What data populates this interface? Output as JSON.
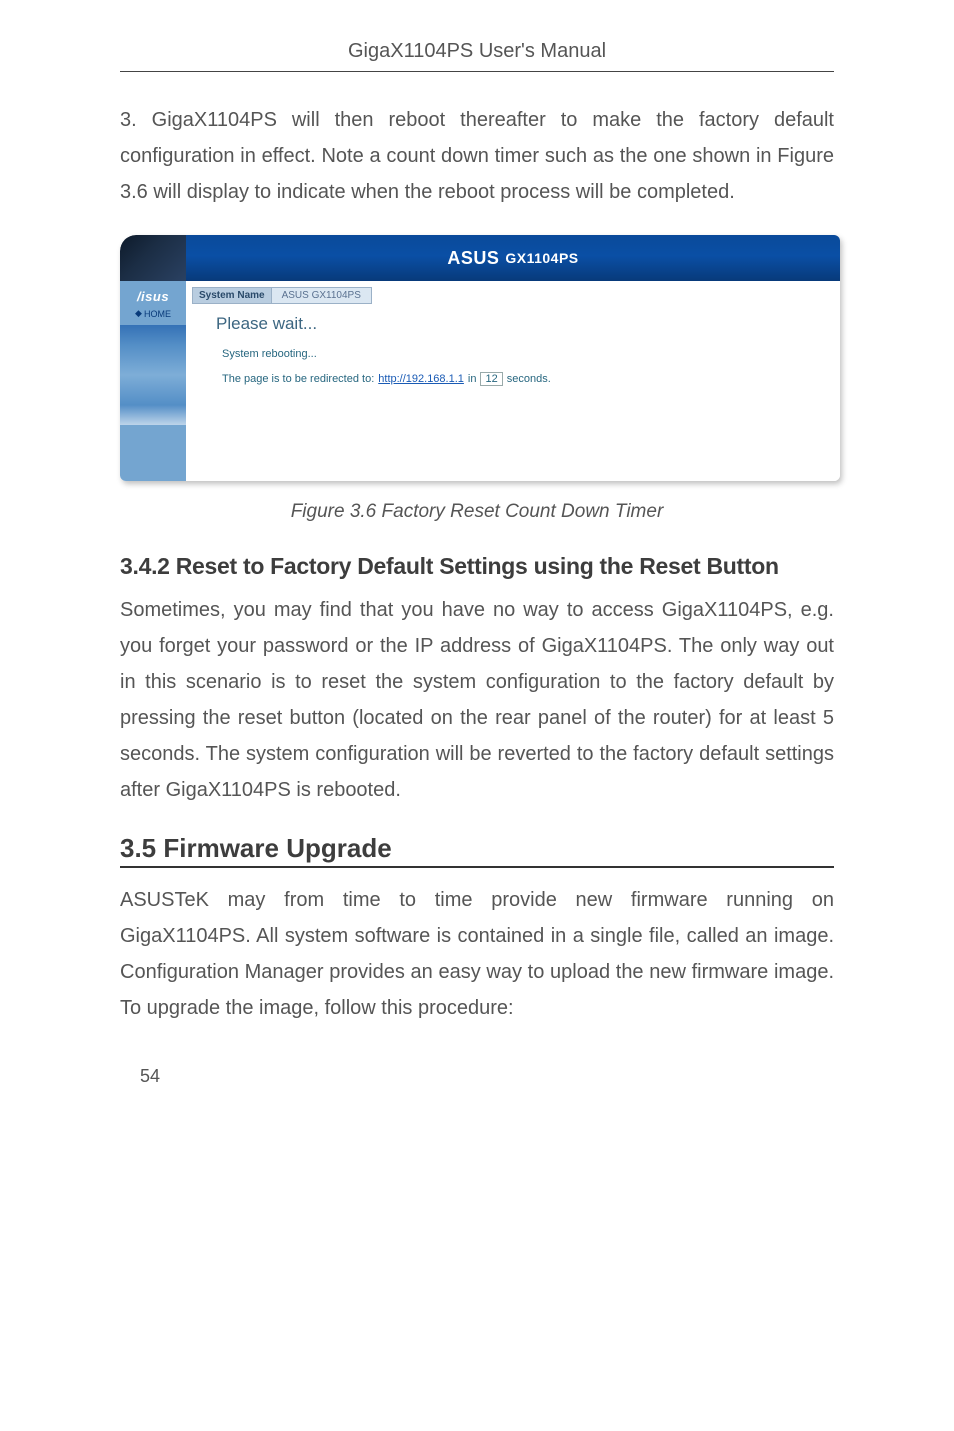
{
  "header": {
    "title": "GigaX1104PS User's Manual"
  },
  "p1": "3. GigaX1104PS will then reboot thereafter to make the factory default configuration in effect. Note a count down timer such as the one shown in Figure 3.6 will display to indicate when the reboot process will be completed.",
  "screenshot": {
    "banner": {
      "asus": "ASUS",
      "model": "GX1104PS"
    },
    "sidebar": {
      "logo": "/isus",
      "home": "HOME"
    },
    "sysname_label": "System Name",
    "sysname_value": "ASUS GX1104PS",
    "please_wait": "Please wait...",
    "rebooting": "System rebooting...",
    "redirect_prefix": "The page is to be redirected to:",
    "redirect_url": "http://192.168.1.1",
    "redirect_in": "in",
    "countdown": "12",
    "redirect_suffix": "seconds."
  },
  "caption": "Figure 3.6 Factory Reset Count Down Timer",
  "h3": "3.4.2 Reset to Factory Default Settings using the Reset Button",
  "p2": "Sometimes, you may find that you have no way to access GigaX1104PS, e.g. you forget your password or the IP address of GigaX1104PS. The only way out in this scenario is to reset the system configuration to the factory default by pressing the reset button (located on the rear panel of the router) for at least 5 seconds. The system configuration will be reverted to the factory default settings after GigaX1104PS is rebooted.",
  "h2": "3.5 Firmware Upgrade",
  "p3": "ASUSTeK may from time to time provide new firmware running on GigaX1104PS. All system software is contained in a single file, called an image. Configuration Manager provides an easy way to upload the new firmware image. To upgrade the image, follow this procedure:",
  "page_number": "54"
}
